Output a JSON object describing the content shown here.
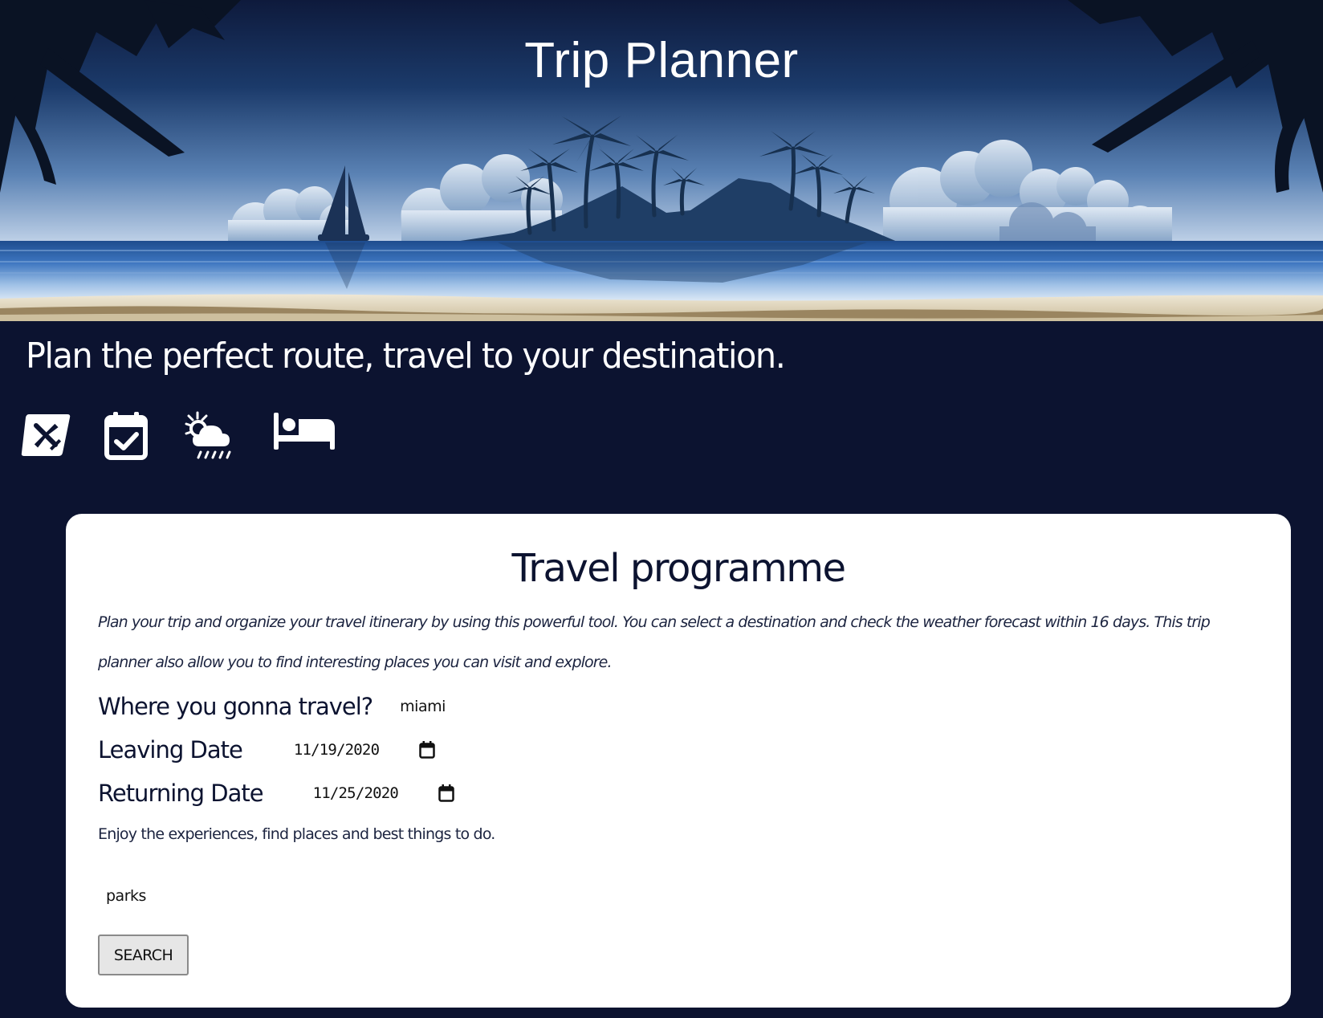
{
  "hero": {
    "title": "Trip Planner"
  },
  "tagline": "Plan the perfect route, travel to your destination.",
  "feature_icons": [
    {
      "name": "flight-icon"
    },
    {
      "name": "calendar-check-icon"
    },
    {
      "name": "weather-icon"
    },
    {
      "name": "hotel-bed-icon"
    }
  ],
  "card": {
    "title": "Travel programme",
    "description": "Plan your trip and organize your travel itinerary by using this powerful tool. You can select a destination and check the weather forecast within 16 days. This trip planner also allow you to find interesting places you can visit and explore.",
    "destination_label": "Where you gonna travel?",
    "destination_value": "miami",
    "leaving_label": "Leaving Date",
    "leaving_value": "11/19/2020",
    "returning_label": "Returning Date",
    "returning_value": "11/25/2020",
    "hint": "Enjoy the experiences, find places and best things to do.",
    "interest_value": "parks",
    "search_label": "SEARCH"
  },
  "colors": {
    "background": "#0c1330",
    "card": "#ffffff",
    "text_dark": "#0c1330"
  }
}
